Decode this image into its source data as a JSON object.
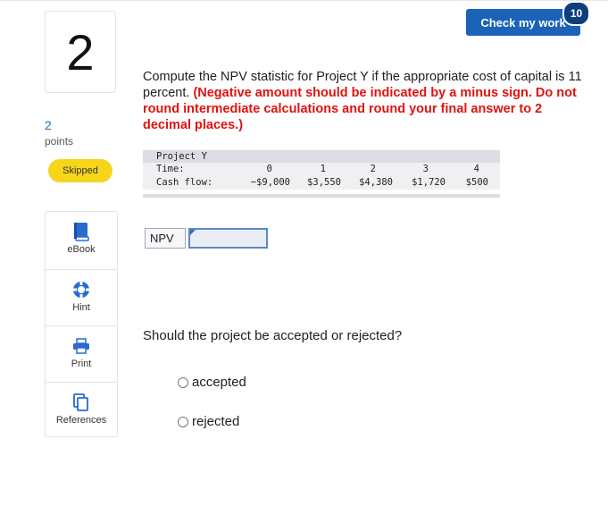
{
  "question": {
    "number": "2",
    "points_value": "2",
    "points_label": "points",
    "status": "Skipped",
    "text_plain": "Compute the NPV statistic for Project Y if the appropriate cost of capital is 11 percent.",
    "text_emphasis": "(Negative amount should be indicated by a minus sign. Do not round intermediate calculations and round your final answer to 2 decimal places.)",
    "followup": "Should the project be accepted or rejected?"
  },
  "check_work": {
    "label": "Check my work",
    "count": "10"
  },
  "tools": [
    {
      "label": "eBook",
      "icon": "book-icon"
    },
    {
      "label": "Hint",
      "icon": "lifebuoy-icon"
    },
    {
      "label": "Print",
      "icon": "printer-icon"
    },
    {
      "label": "References",
      "icon": "documents-icon"
    }
  ],
  "project_table": {
    "title": "Project Y",
    "time_label": "Time:",
    "cashflow_label": "Cash flow:",
    "times": [
      "0",
      "1",
      "2",
      "3",
      "4"
    ],
    "cash_flows": [
      "−$9,000",
      "$3,550",
      "$4,380",
      "$1,720",
      "$500"
    ]
  },
  "answer": {
    "npv_label": "NPV",
    "npv_value": ""
  },
  "options": [
    "accepted",
    "rejected"
  ],
  "colors": {
    "accent": "#1b63b9",
    "badge": "#0d3f7f",
    "emphasis": "#e0130f",
    "skipped": "#f6d51b"
  }
}
